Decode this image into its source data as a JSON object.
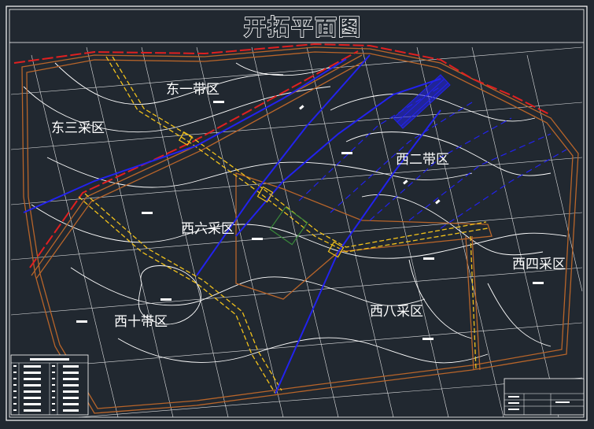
{
  "drawing": {
    "title": "开拓平面图",
    "zones": [
      {
        "id": "dong-yi",
        "label": "东一带区"
      },
      {
        "id": "dong-san",
        "label": "东三采区"
      },
      {
        "id": "xi-er",
        "label": "西二带区"
      },
      {
        "id": "xi-liu",
        "label": "西六采区"
      },
      {
        "id": "xi-si",
        "label": "西四采区"
      },
      {
        "id": "xi-ba",
        "label": "西八采区"
      },
      {
        "id": "xi-shi",
        "label": "西十带区"
      }
    ]
  },
  "colors": {
    "background": "#212830",
    "frame": "#ffffff",
    "boundary_red": "#e02020",
    "boundary_orange": "#b8652a",
    "roadway_yellow": "#f2c21b",
    "roadway_blue": "#2222ee",
    "contour_white": "#ffffff"
  }
}
